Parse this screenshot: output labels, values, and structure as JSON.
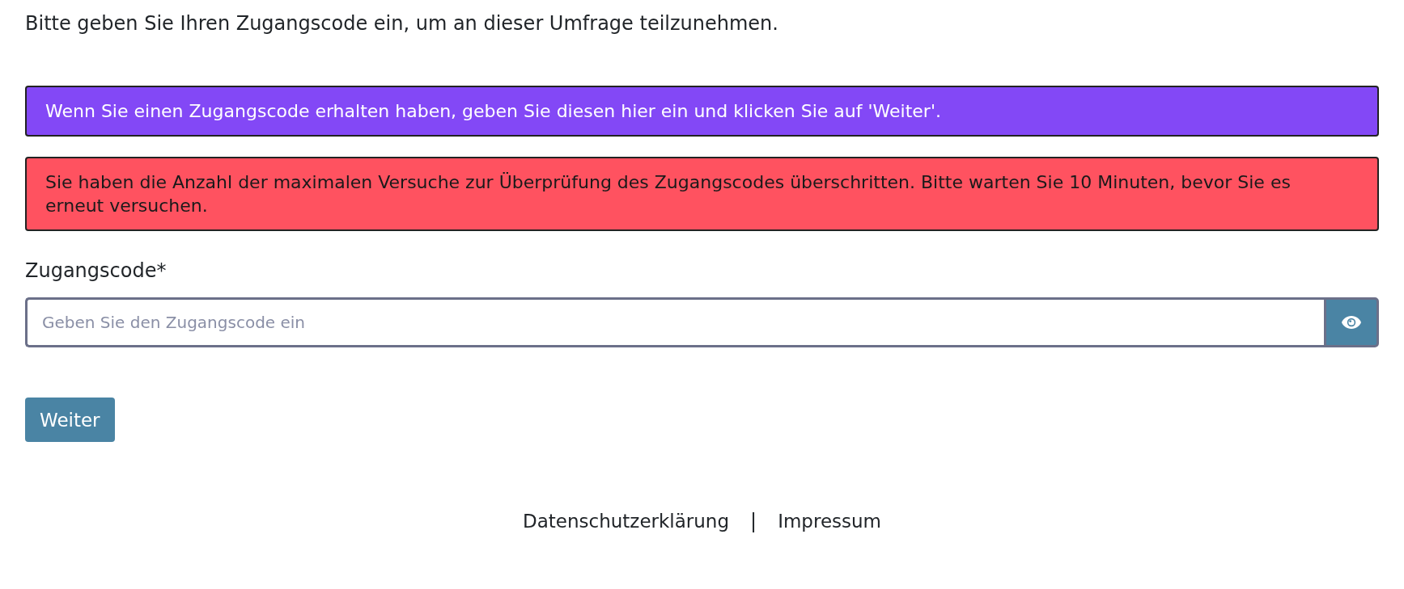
{
  "intro": "Bitte geben Sie Ihren Zugangscode ein, um an dieser Umfrage teilzunehmen.",
  "alerts": [
    {
      "kind": "info",
      "text": "Wenn Sie einen Zugangscode erhalten haben, geben Sie diesen hier ein und klicken Sie auf 'Weiter'."
    },
    {
      "kind": "error",
      "text": "Sie haben die Anzahl der maximalen Versuche zur Überprüfung des Zugangscodes überschritten. Bitte warten Sie 10 Minuten, bevor Sie es erneut versuchen."
    }
  ],
  "field": {
    "label": "Zugangscode*",
    "placeholder": "Geben Sie den Zugangscode ein"
  },
  "submit": "Weiter",
  "footer": {
    "links": [
      "Datenschutzerklärung",
      "Impressum"
    ],
    "separator": "|"
  }
}
